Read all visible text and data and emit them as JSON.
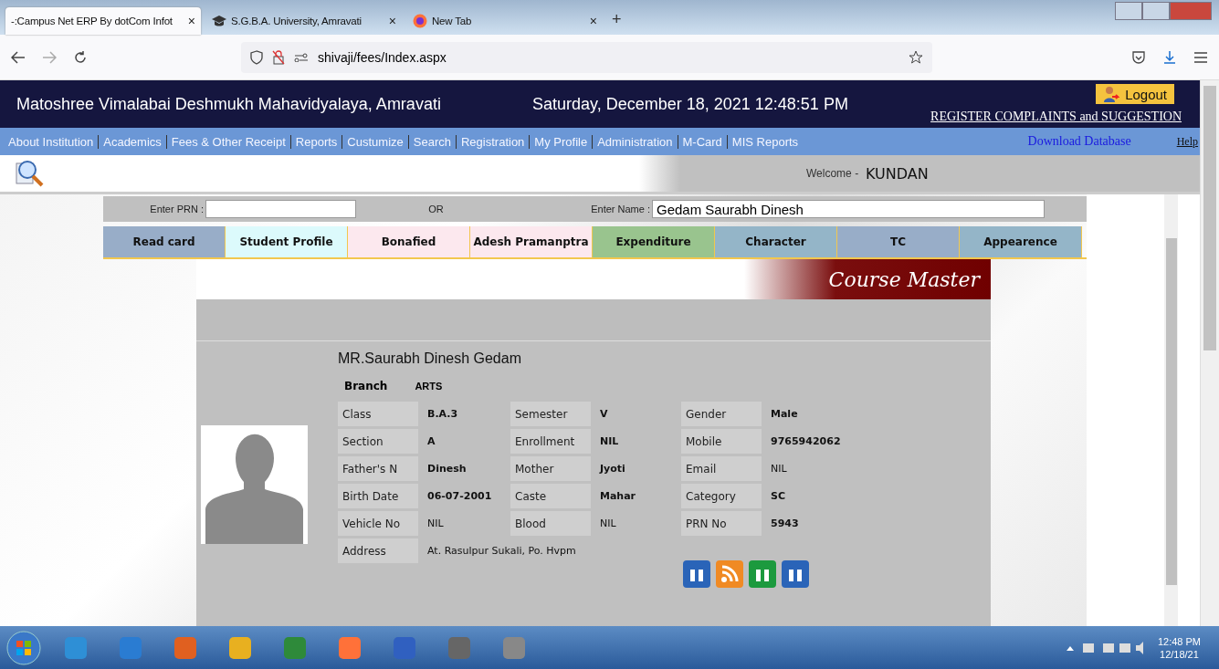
{
  "browser": {
    "tabs": [
      {
        "title": "-:Campus Net ERP By dotCom Infot",
        "selected": true,
        "close": "×"
      },
      {
        "title": "S.G.B.A. University, Amravati",
        "selected": false,
        "close": "×"
      },
      {
        "title": "New Tab",
        "selected": false,
        "close": "×"
      }
    ],
    "new_tab": "+",
    "address": "shivaji/fees/Index.aspx"
  },
  "header": {
    "institution": "Matoshree Vimalabai Deshmukh Mahavidyalaya, Amravati",
    "datetime": "Saturday, December 18, 2021 12:48:51 PM",
    "logout": "Logout",
    "complaints": "REGISTER COMPLAINTS and SUGGESTION"
  },
  "menu": {
    "items": [
      "About Institution",
      "Academics",
      "Fees & Other Receipt",
      "Reports",
      "Custumize",
      "Search",
      "Registration",
      "My Profile",
      "Administration",
      "M-Card",
      "MIS Reports"
    ],
    "download": "Download Database",
    "help": "Help"
  },
  "welcome": {
    "label": "Welcome -",
    "user": "KUNDAN"
  },
  "search": {
    "prn_label": "Enter PRN :",
    "or": "OR",
    "name_label": "Enter Name :",
    "name_value": "Gedam Saurabh Dinesh"
  },
  "actions": [
    {
      "label": "Read card",
      "color": "#98adc8"
    },
    {
      "label": "Student Profile",
      "color": "#dcfafc"
    },
    {
      "label": "Bonafied",
      "color": "#fce8ee"
    },
    {
      "label": "Adesh Pramanptra",
      "color": "#fce8ee"
    },
    {
      "label": "Expenditure",
      "color": "#99c48e"
    },
    {
      "label": "Character",
      "color": "#94b5c8"
    },
    {
      "label": "TC",
      "color": "#98adc8"
    },
    {
      "label": "Appearence",
      "color": "#94b5c8"
    }
  ],
  "banner": "Course Master",
  "profile": {
    "name": "MR.Saurabh Dinesh Gedam",
    "branch_label": "Branch",
    "branch_value": "ARTS",
    "rows": [
      [
        {
          "label": "Class",
          "value": "B.A.3",
          "bold": true
        },
        {
          "label": "Semester",
          "value": "V",
          "bold": true
        },
        {
          "label": "Gender",
          "value": "Male",
          "bold": true
        }
      ],
      [
        {
          "label": "Section",
          "value": "A",
          "bold": true
        },
        {
          "label": "Enrollment",
          "value": "NIL",
          "bold": true
        },
        {
          "label": "Mobile",
          "value": "9765942062",
          "bold": true
        }
      ],
      [
        {
          "label": "Father's N",
          "value": "Dinesh",
          "bold": true
        },
        {
          "label": "Mother",
          "value": "Jyoti",
          "bold": true
        },
        {
          "label": "Email",
          "value": "NIL",
          "bold": false
        }
      ],
      [
        {
          "label": "Birth Date",
          "value": "06-07-2001",
          "bold": true
        },
        {
          "label": "Caste",
          "value": "Mahar",
          "bold": true
        },
        {
          "label": "Category",
          "value": "SC",
          "bold": true
        }
      ],
      [
        {
          "label": "Vehicle No",
          "value": "NIL",
          "bold": false
        },
        {
          "label": "Blood",
          "value": "NIL",
          "bold": false
        },
        {
          "label": "PRN No",
          "value": "5943",
          "bold": true
        }
      ],
      [
        {
          "label": "Address",
          "value": "At. Rasulpur Sukali, Po. Hvpm",
          "bold": false
        }
      ]
    ]
  },
  "taskbar": {
    "time": "12:48 PM",
    "date": "12/18/21"
  }
}
